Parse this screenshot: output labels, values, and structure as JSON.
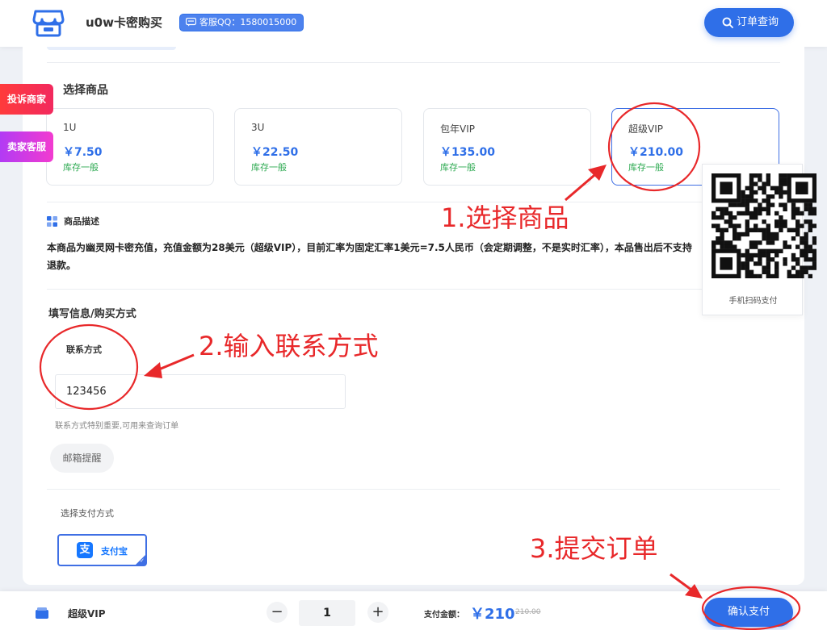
{
  "header": {
    "site_title": "u0w卡密购买",
    "qq_badge": "客服QQ：1580015000",
    "order_query": "订单查询"
  },
  "side_tabs": {
    "complain": "投诉商家",
    "seller_service": "卖家客服"
  },
  "products": {
    "section_title": "选择商品",
    "items": [
      {
        "name": "1U",
        "price": "￥7.50",
        "stock": "库存一般",
        "selected": false
      },
      {
        "name": "3U",
        "price": "￥22.50",
        "stock": "库存一般",
        "selected": false
      },
      {
        "name": "包年VIP",
        "price": "￥135.00",
        "stock": "库存一般",
        "selected": false
      },
      {
        "name": "超级VIP",
        "price": "￥210.00",
        "stock": "库存一般",
        "selected": true
      }
    ]
  },
  "description": {
    "title": "商品描述",
    "text": "本商品为幽灵网卡密充值，充值金额为28美元（超级VIP），目前汇率为固定汇率1美元=7.5人民币（会定期调整，不是实时汇率），本品售出后不支持退款。"
  },
  "form": {
    "section_title": "填写信息/购买方式",
    "contact_label": "联系方式",
    "contact_value": "123456",
    "contact_hint": "联系方式特别重要,可用来查询订单",
    "email_reminder": "邮箱提醒"
  },
  "payment": {
    "section_title": "选择支付方式",
    "method": "支付宝",
    "method_logo": "支"
  },
  "qr": {
    "caption": "手机扫码支付"
  },
  "annotations": {
    "step1": "1.选择商品",
    "step2": "2.输入联系方式",
    "step3": "3.提交订单",
    "color": "#e8282a"
  },
  "bottom_bar": {
    "product_name": "超级VIP",
    "minus": "−",
    "plus": "+",
    "quantity": "1",
    "pay_label": "支付金额：",
    "pay_amount": "￥210",
    "original_price": "210.00",
    "confirm": "确认支付"
  },
  "colors": {
    "accent": "#2f6fe8",
    "stock_green": "#2eaa52",
    "complain_red": "#ff3b3b",
    "service_purple": "#c43bf0"
  }
}
